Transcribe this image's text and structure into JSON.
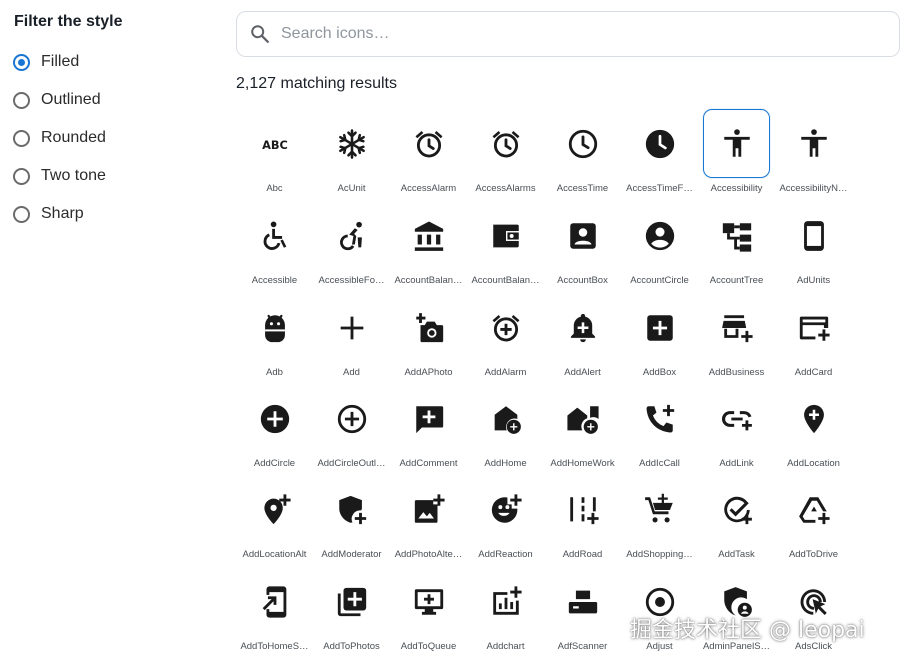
{
  "filter": {
    "title": "Filter the style",
    "options": [
      {
        "label": "Filled",
        "checked": true
      },
      {
        "label": "Outlined",
        "checked": false
      },
      {
        "label": "Rounded",
        "checked": false
      },
      {
        "label": "Two tone",
        "checked": false
      },
      {
        "label": "Sharp",
        "checked": false
      }
    ]
  },
  "search": {
    "placeholder": "Search icons…",
    "value": ""
  },
  "results": {
    "count_text": "2,127 matching results"
  },
  "icons": [
    {
      "name": "Abc",
      "glyph": "abc-icon"
    },
    {
      "name": "AcUnit",
      "glyph": "snowflake-icon"
    },
    {
      "name": "AccessAlarm",
      "glyph": "alarm-icon"
    },
    {
      "name": "AccessAlarms",
      "glyph": "alarm-icon"
    },
    {
      "name": "AccessTime",
      "glyph": "clock-outline-icon"
    },
    {
      "name": "AccessTimeF…",
      "glyph": "clock-filled-icon"
    },
    {
      "name": "Accessibility",
      "glyph": "accessibility-icon",
      "selected": true
    },
    {
      "name": "AccessibilityN…",
      "glyph": "accessibility-icon"
    },
    {
      "name": "Accessible",
      "glyph": "wheelchair-icon"
    },
    {
      "name": "AccessibleFo…",
      "glyph": "wheelchair-forward-icon"
    },
    {
      "name": "AccountBalan…",
      "glyph": "bank-icon"
    },
    {
      "name": "AccountBalan…",
      "glyph": "wallet-icon"
    },
    {
      "name": "AccountBox",
      "glyph": "account-box-icon"
    },
    {
      "name": "AccountCircle",
      "glyph": "account-circle-icon"
    },
    {
      "name": "AccountTree",
      "glyph": "account-tree-icon"
    },
    {
      "name": "AdUnits",
      "glyph": "phone-icon"
    },
    {
      "name": "Adb",
      "glyph": "android-icon"
    },
    {
      "name": "Add",
      "glyph": "plus-icon"
    },
    {
      "name": "AddAPhoto",
      "glyph": "add-photo-icon"
    },
    {
      "name": "AddAlarm",
      "glyph": "add-alarm-icon"
    },
    {
      "name": "AddAlert",
      "glyph": "add-alert-icon"
    },
    {
      "name": "AddBox",
      "glyph": "add-box-icon"
    },
    {
      "name": "AddBusiness",
      "glyph": "add-business-icon"
    },
    {
      "name": "AddCard",
      "glyph": "add-card-icon"
    },
    {
      "name": "AddCircle",
      "glyph": "add-circle-icon"
    },
    {
      "name": "AddCircleOutl…",
      "glyph": "add-circle-outline-icon"
    },
    {
      "name": "AddComment",
      "glyph": "add-comment-icon"
    },
    {
      "name": "AddHome",
      "glyph": "add-home-icon"
    },
    {
      "name": "AddHomeWork",
      "glyph": "add-home-work-icon"
    },
    {
      "name": "AddIcCall",
      "glyph": "add-call-icon"
    },
    {
      "name": "AddLink",
      "glyph": "add-link-icon"
    },
    {
      "name": "AddLocation",
      "glyph": "add-location-icon"
    },
    {
      "name": "AddLocationAlt",
      "glyph": "add-location-alt-icon"
    },
    {
      "name": "AddModerator",
      "glyph": "add-moderator-icon"
    },
    {
      "name": "AddPhotoAlte…",
      "glyph": "add-photo-alternate-icon"
    },
    {
      "name": "AddReaction",
      "glyph": "add-reaction-icon"
    },
    {
      "name": "AddRoad",
      "glyph": "add-road-icon"
    },
    {
      "name": "AddShopping…",
      "glyph": "add-shopping-cart-icon"
    },
    {
      "name": "AddTask",
      "glyph": "add-task-icon"
    },
    {
      "name": "AddToDrive",
      "glyph": "add-to-drive-icon"
    },
    {
      "name": "AddToHomeS…",
      "glyph": "add-to-home-screen-icon"
    },
    {
      "name": "AddToPhotos",
      "glyph": "add-to-photos-icon"
    },
    {
      "name": "AddToQueue",
      "glyph": "add-to-queue-icon"
    },
    {
      "name": "Addchart",
      "glyph": "addchart-icon"
    },
    {
      "name": "AdfScanner",
      "glyph": "scanner-icon"
    },
    {
      "name": "Adjust",
      "glyph": "adjust-icon"
    },
    {
      "name": "AdminPanelS…",
      "glyph": "admin-panel-icon"
    },
    {
      "name": "AdsClick",
      "glyph": "ads-click-icon"
    }
  ],
  "watermark": "掘金技术社区 @ leopai",
  "colors": {
    "accent": "#1976d2",
    "icon": "#1a1a1a",
    "text": "#1a2027",
    "border": "#d8dde3"
  }
}
